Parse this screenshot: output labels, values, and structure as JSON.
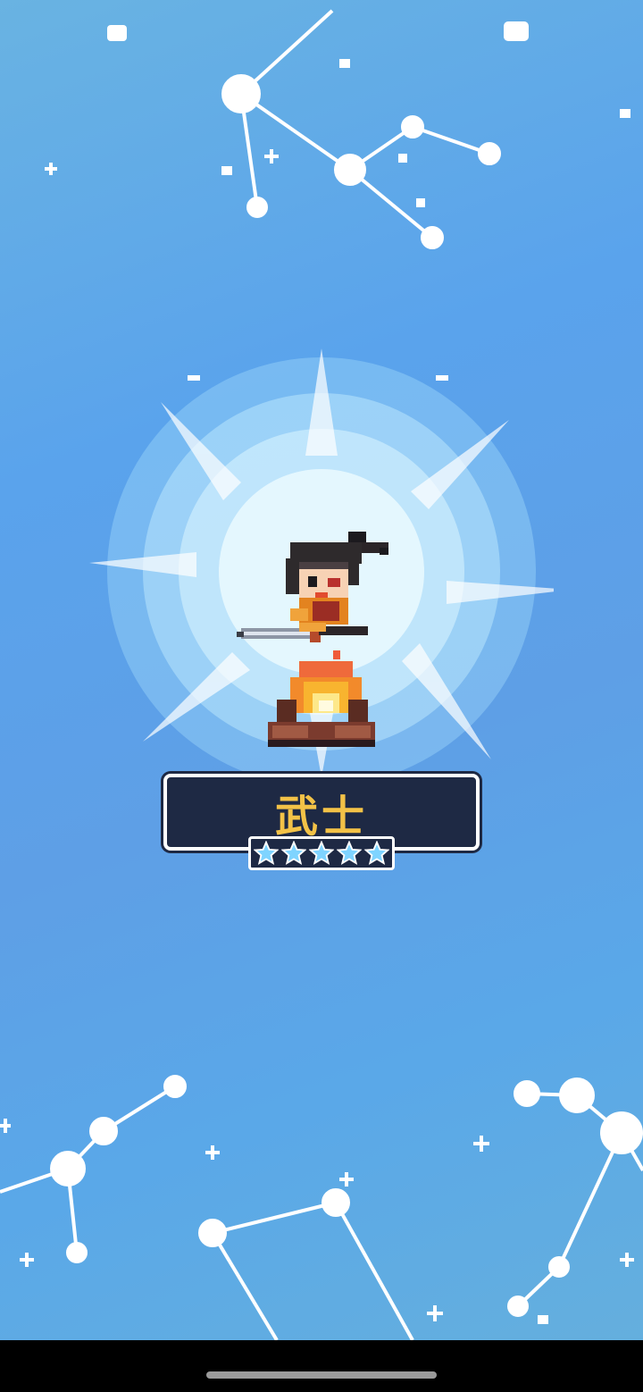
{
  "hero": {
    "class_name": "武士",
    "star_rating": 5,
    "star_max": 5
  },
  "colors": {
    "nameplate_bg": "#1e2944",
    "class_name_text": "#f3c247",
    "star_fill": "#7fd4ff",
    "sky_top": "#69b3e2",
    "sky_mid": "#5e9fe6"
  },
  "icons": [
    "constellation-top",
    "constellation-bottom-left",
    "constellation-bottom-center",
    "constellation-bottom-right",
    "light-burst",
    "warrior-character",
    "campfire-icon",
    "star-icon",
    "home-indicator"
  ]
}
